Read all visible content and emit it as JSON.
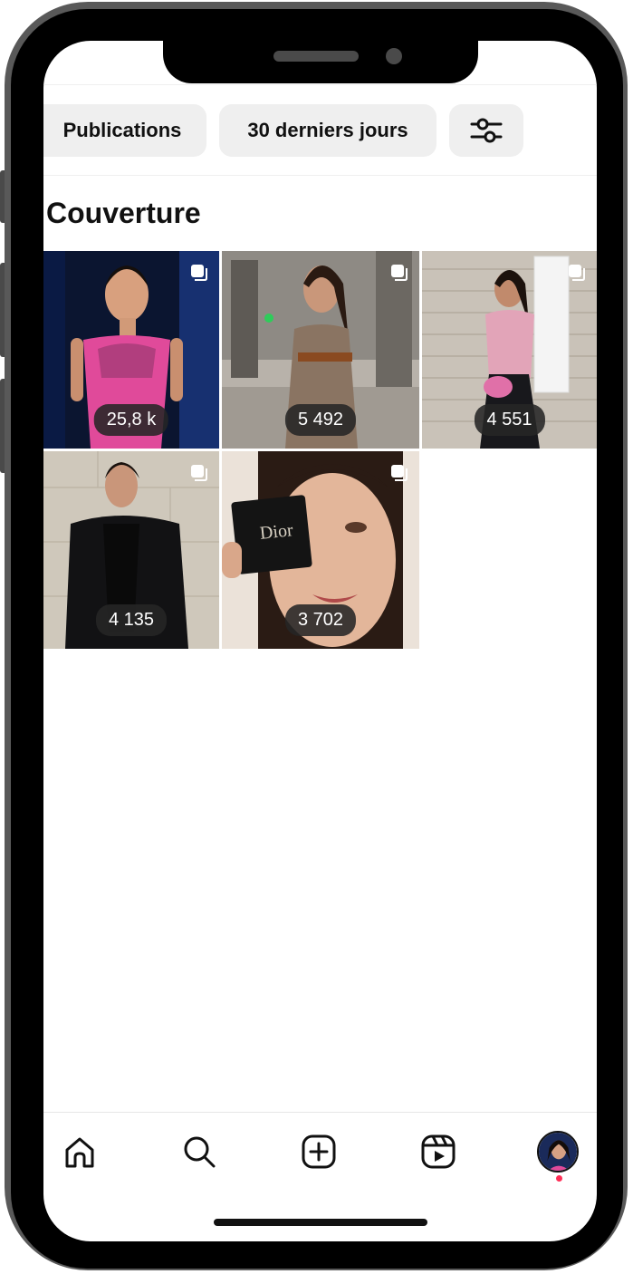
{
  "filters": {
    "type_label": "Publications",
    "period_label": "30 derniers jours",
    "settings_icon": "sliders-icon"
  },
  "section": {
    "title": "Couverture"
  },
  "posts": [
    {
      "count": "25,8 k",
      "multi": true
    },
    {
      "count": "5 492",
      "multi": true
    },
    {
      "count": "4 551",
      "multi": true
    },
    {
      "count": "4 135",
      "multi": true
    },
    {
      "count": "3 702",
      "multi": true
    }
  ],
  "product_text": "Dior",
  "nav": {
    "items": [
      "home-icon",
      "search-icon",
      "create-icon",
      "reels-icon",
      "profile-avatar"
    ],
    "notification_color": "#ff2d55"
  }
}
